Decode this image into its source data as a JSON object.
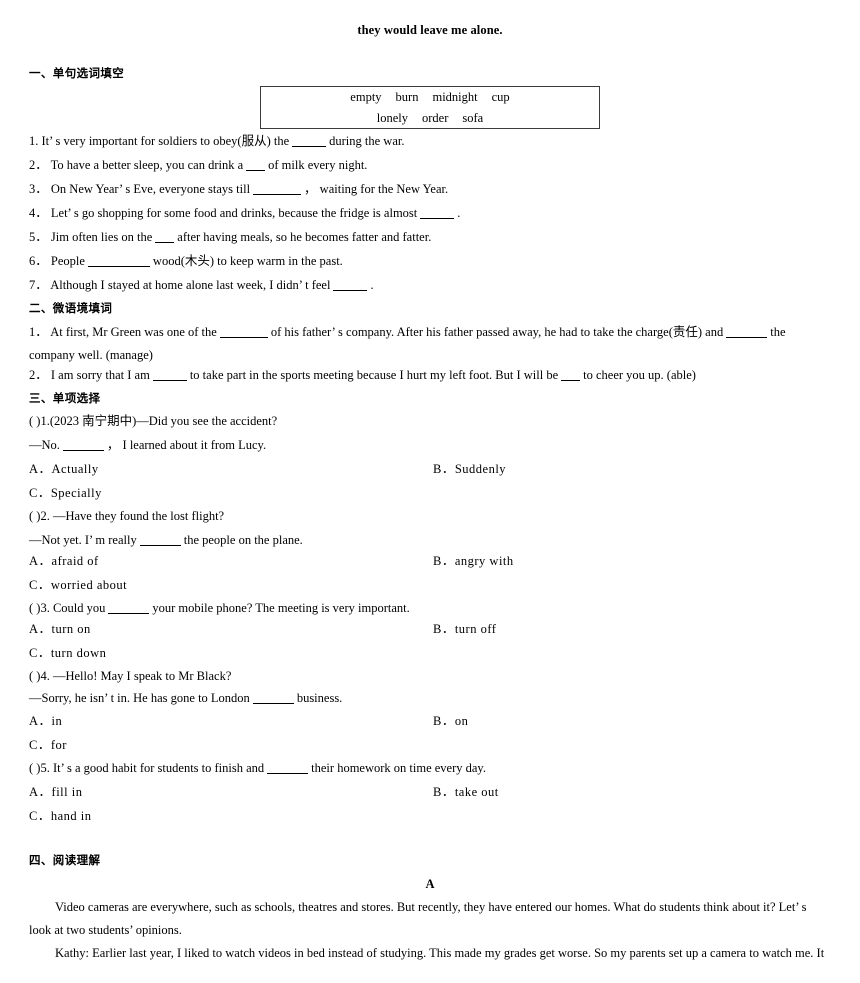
{
  "document": {
    "running_header": "they would leave me alone."
  },
  "sections": {
    "one": {
      "heading": "一、单句选词填空",
      "word_bank": {
        "row1": [
          "empty",
          "burn",
          "midnight",
          "cup"
        ],
        "row2": [
          "lonely",
          "order",
          "sofa"
        ]
      },
      "items": [
        {
          "number": "1.",
          "before": "It’ s very important for soldiers to obey(服从) the",
          "after": "during the war."
        },
        {
          "number": "2．",
          "before": "To have a better sleep, you can drink a",
          "after": "of milk every night."
        },
        {
          "number": "3．",
          "before": "On New Year’ s Eve, everyone stays till",
          "after": "，   waiting for the New Year."
        },
        {
          "number": "4．",
          "before": "Let’ s go shopping for some food and drinks, because the fridge is almost",
          "after": "."
        },
        {
          "number": "5．",
          "before": "Jim often lies on the",
          "after": "after having meals, so he becomes fatter and fatter."
        },
        {
          "number": "6．",
          "before": "People",
          "after": "wood(木头) to keep warm in the past."
        },
        {
          "number": "7．",
          "before": "Although I stayed at home alone last week, I didn’ t feel",
          "after": "."
        }
      ]
    },
    "two": {
      "heading": "二、微语境填词",
      "items": [
        {
          "number": "1．",
          "part1": "At first, Mr Green was one of the",
          "part2": "of his father’ s company. After his father passed away, he had to take the charge(责任) and",
          "part3": "the company well. (manage)"
        },
        {
          "number": "2．",
          "part1": "I am sorry that I am",
          "part2": "to take part in the sports meeting because I hurt my left foot. But I will be",
          "part3": "to cheer you up. (able)"
        }
      ]
    },
    "three": {
      "heading": "三、单项选择",
      "questions": [
        {
          "marker": "(  )1.",
          "source": "(2023 南宁期中)",
          "stem": "—Did you see the accident?",
          "reply_before": "—No.",
          "reply_after": "，   I learned about it from Lucy.",
          "options": {
            "a": "A．Actually",
            "b": "B．Suddenly",
            "c": "C．Specially"
          }
        },
        {
          "marker": "(  )2.",
          "stem": "—Have they found the lost flight?",
          "reply_before": "—Not yet. I’ m really",
          "reply_after": "the people on the plane.",
          "options": {
            "a": "A．afraid of",
            "b": "B．angry with",
            "c": "C．worried about"
          }
        },
        {
          "marker": "(  )3.",
          "stem_before": "Could you",
          "stem_after": "your mobile phone? The meeting is very important.",
          "options": {
            "a": "A．turn on",
            "b": "B．turn off",
            "c": "C．turn down"
          }
        },
        {
          "marker": "(  )4.",
          "stem": "—Hello! May I speak to Mr Black?",
          "reply_before": "—Sorry, he isn’ t in. He has gone to London",
          "reply_after": "business.",
          "options": {
            "a": "A．in",
            "b": "B．on",
            "c": "C．for"
          }
        },
        {
          "marker": "(  )5.",
          "stem_before": "It’ s a good habit for students to finish and",
          "stem_after": "their homework on time every day.",
          "options": {
            "a": "A．fill in",
            "b": "B．take out",
            "c": "C．hand in"
          }
        }
      ]
    },
    "four": {
      "heading": "四、阅读理解",
      "passage_label": "A",
      "paragraph1": "Video cameras are everywhere, such as schools, theatres and stores. But recently, they have entered our homes. What do students think about it? Let’ s look at two students’ opinions.",
      "paragraph2": "Kathy: Earlier last year, I liked to watch videos in bed instead of studying. This made my grades get worse. So my parents set up a camera to watch me. It"
    }
  }
}
